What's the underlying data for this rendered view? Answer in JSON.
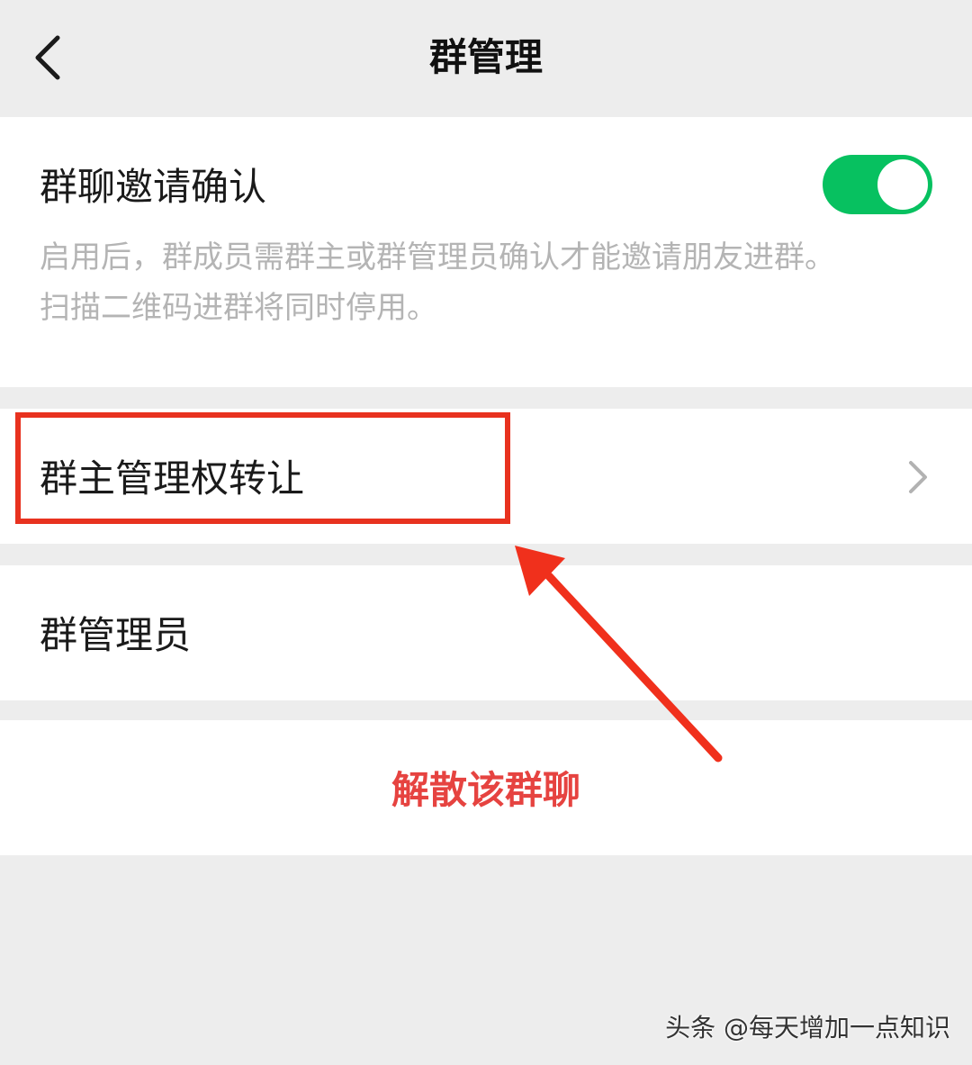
{
  "nav": {
    "title": "群管理",
    "back_icon": "chevron-left-icon"
  },
  "invite_confirm": {
    "label": "群聊邀请确认",
    "enabled": true,
    "description_lines": [
      "启用后，群成员需群主或群管理员确认才能邀请朋友进群。",
      "扫描二维码进群将同时停用。"
    ]
  },
  "transfer_owner": {
    "label": "群主管理权转让",
    "chevron_icon": "chevron-right-icon"
  },
  "admins": {
    "label": "群管理员"
  },
  "dissolve": {
    "label": "解散该群聊"
  },
  "annotation": {
    "highlight_color": "#e8321f",
    "arrow_color": "#f0301c"
  },
  "watermark": {
    "text": "头条 @每天增加一点知识"
  },
  "colors": {
    "accent_green": "#07c160",
    "danger_red": "#e64340",
    "page_bg": "#ededed",
    "card_bg": "#ffffff",
    "desc_text": "#b4b4b4"
  }
}
